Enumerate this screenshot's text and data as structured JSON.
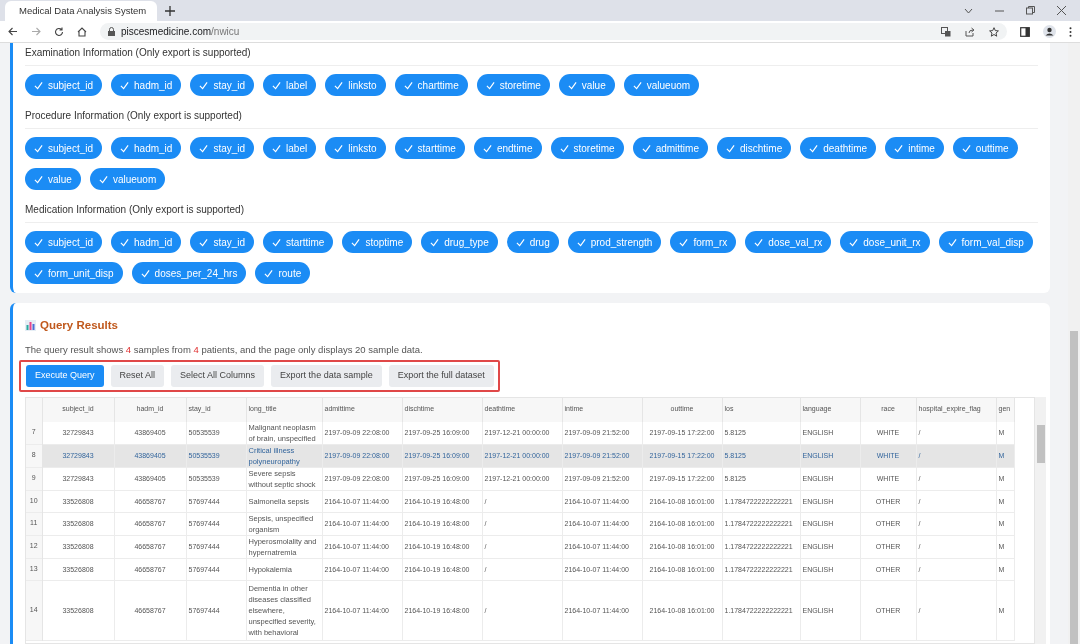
{
  "browser": {
    "tab_title": "Medical Data Analysis System",
    "url_host": "piscesmedicine.com",
    "url_path": "/nwicu"
  },
  "sections": [
    {
      "title": "Examination Information (Only export is supported)",
      "fields": [
        {
          "label": "subject_id",
          "checked": true
        },
        {
          "label": "hadm_id",
          "checked": true
        },
        {
          "label": "stay_id",
          "checked": true
        },
        {
          "label": "label",
          "checked": true
        },
        {
          "label": "linksto",
          "checked": true
        },
        {
          "label": "charttime",
          "checked": true
        },
        {
          "label": "storetime",
          "checked": true
        },
        {
          "label": "value",
          "checked": true
        },
        {
          "label": "valueuom",
          "checked": true
        }
      ]
    },
    {
      "title": "Procedure Information (Only export is supported)",
      "fields": [
        {
          "label": "subject_id",
          "checked": true
        },
        {
          "label": "hadm_id",
          "checked": true
        },
        {
          "label": "stay_id",
          "checked": true
        },
        {
          "label": "label",
          "checked": true
        },
        {
          "label": "linksto",
          "checked": true
        },
        {
          "label": "starttime",
          "checked": true
        },
        {
          "label": "endtime",
          "checked": true
        },
        {
          "label": "storetime",
          "checked": true
        },
        {
          "label": "admittime",
          "checked": true
        },
        {
          "label": "dischtime",
          "checked": true
        },
        {
          "label": "deathtime",
          "checked": true
        },
        {
          "label": "intime",
          "checked": true
        },
        {
          "label": "outtime",
          "checked": true
        },
        {
          "label": "value",
          "checked": true
        },
        {
          "label": "valueuom",
          "checked": true
        }
      ]
    },
    {
      "title": "Medication Information (Only export is supported)",
      "fields": [
        {
          "label": "subject_id",
          "checked": true
        },
        {
          "label": "hadm_id",
          "checked": true
        },
        {
          "label": "stay_id",
          "checked": true
        },
        {
          "label": "starttime",
          "checked": true
        },
        {
          "label": "stoptime",
          "checked": true
        },
        {
          "label": "drug_type",
          "checked": true
        },
        {
          "label": "drug",
          "checked": true
        },
        {
          "label": "prod_strength",
          "checked": true
        },
        {
          "label": "form_rx",
          "checked": true
        },
        {
          "label": "dose_val_rx",
          "checked": true
        },
        {
          "label": "dose_unit_rx",
          "checked": true
        },
        {
          "label": "form_val_disp",
          "checked": true
        },
        {
          "label": "form_unit_disp",
          "checked": true
        },
        {
          "label": "doses_per_24_hrs",
          "checked": true
        },
        {
          "label": "route",
          "checked": true
        }
      ]
    }
  ],
  "results": {
    "title": "Query Results",
    "summary": [
      {
        "kind": "plain",
        "text": "The query result shows "
      },
      {
        "kind": "count",
        "text": "4"
      },
      {
        "kind": "plain",
        "text": " samples from "
      },
      {
        "kind": "count",
        "text": "4"
      },
      {
        "kind": "plain",
        "text": " patients, and the page only displays 20 sample data."
      }
    ],
    "buttons_highlighted": true,
    "buttons": [
      {
        "label": "Execute Query",
        "kind": "primary"
      },
      {
        "label": "Reset All",
        "kind": "secondary"
      },
      {
        "label": "Select All Columns",
        "kind": "secondary"
      },
      {
        "label": "Export the data sample",
        "kind": "secondary"
      },
      {
        "label": "Export the full dataset",
        "kind": "secondary"
      }
    ],
    "table": {
      "columns": [
        "subject_id",
        "hadm_id",
        "stay_id",
        "long_title",
        "admittime",
        "dischtime",
        "deathtime",
        "intime",
        "outtime",
        "los",
        "language",
        "race",
        "hospital_expire_flag",
        "gen"
      ],
      "rows": [
        {
          "index": "7",
          "selected": false,
          "cells": [
            "32729843",
            "43869405",
            "50535539",
            "Malignant neoplasm of brain, unspecified",
            "2197-09-09 22:08:00",
            "2197-09-25 16:09:00",
            "2197-12-21 00:00:00",
            "2197-09-09 21:52:00",
            "2197-09-15 17:22:00",
            "5.8125",
            "ENGLISH",
            "WHITE",
            "/",
            "M"
          ]
        },
        {
          "index": "8",
          "selected": true,
          "cells": [
            "32729843",
            "43869405",
            "50535539",
            "Critical illness polyneuropathy",
            "2197-09-09 22:08:00",
            "2197-09-25 16:09:00",
            "2197-12-21 00:00:00",
            "2197-09-09 21:52:00",
            "2197-09-15 17:22:00",
            "5.8125",
            "ENGLISH",
            "WHITE",
            "/",
            "M"
          ]
        },
        {
          "index": "9",
          "selected": false,
          "cells": [
            "32729843",
            "43869405",
            "50535539",
            "Severe sepsis without septic shock",
            "2197-09-09 22:08:00",
            "2197-09-25 16:09:00",
            "2197-12-21 00:00:00",
            "2197-09-09 21:52:00",
            "2197-09-15 17:22:00",
            "5.8125",
            "ENGLISH",
            "WHITE",
            "/",
            "M"
          ]
        },
        {
          "index": "10",
          "selected": false,
          "cells": [
            "33526808",
            "46658767",
            "57697444",
            "Salmonella sepsis",
            "2164-10-07 11:44:00",
            "2164-10-19 16:48:00",
            "/",
            "2164-10-07 11:44:00",
            "2164-10-08 16:01:00",
            "1.1784722222222221",
            "ENGLISH",
            "OTHER",
            "/",
            "M"
          ]
        },
        {
          "index": "11",
          "selected": false,
          "cells": [
            "33526808",
            "46658767",
            "57697444",
            "Sepsis, unspecified organism",
            "2164-10-07 11:44:00",
            "2164-10-19 16:48:00",
            "/",
            "2164-10-07 11:44:00",
            "2164-10-08 16:01:00",
            "1.1784722222222221",
            "ENGLISH",
            "OTHER",
            "/",
            "M"
          ]
        },
        {
          "index": "12",
          "selected": false,
          "cells": [
            "33526808",
            "46658767",
            "57697444",
            "Hyperosmolality and hypernatremia",
            "2164-10-07 11:44:00",
            "2164-10-19 16:48:00",
            "/",
            "2164-10-07 11:44:00",
            "2164-10-08 16:01:00",
            "1.1784722222222221",
            "ENGLISH",
            "OTHER",
            "/",
            "M"
          ]
        },
        {
          "index": "13",
          "selected": false,
          "cells": [
            "33526808",
            "46658767",
            "57697444",
            "Hypokalemia",
            "2164-10-07 11:44:00",
            "2164-10-19 16:48:00",
            "/",
            "2164-10-07 11:44:00",
            "2164-10-08 16:01:00",
            "1.1784722222222221",
            "ENGLISH",
            "OTHER",
            "/",
            "M"
          ]
        },
        {
          "index": "14",
          "selected": false,
          "cells": [
            "33526808",
            "46658767",
            "57697444",
            "Dementia in other diseases classified elsewhere, unspecified severity, with behavioral",
            "2164-10-07 11:44:00",
            "2164-10-19 16:48:00",
            "/",
            "2164-10-07 11:44:00",
            "2164-10-08 16:01:00",
            "1.1784722222222221",
            "ENGLISH",
            "OTHER",
            "/",
            "M"
          ]
        }
      ]
    }
  }
}
